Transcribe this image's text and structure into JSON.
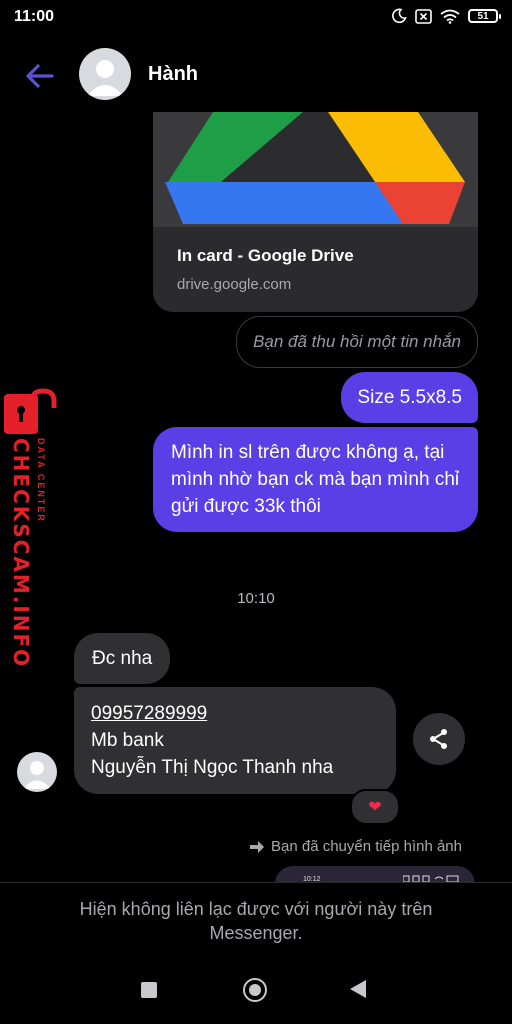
{
  "status_bar": {
    "time": "11:00",
    "battery": "51",
    "icons": [
      "moon-icon",
      "close-box-icon",
      "wifi-icon",
      "battery-icon"
    ]
  },
  "header": {
    "contact_name": "Hành",
    "accent_color": "#5b4fd6"
  },
  "messages": {
    "link_card": {
      "title": "In card - Google Drive",
      "domain": "drive.google.com"
    },
    "recalled_notice": "Bạn đã thu hồi một tin nhắn",
    "outgoing_size": "Size 5.5x8.5",
    "outgoing_long": "Mình in sl trên được không ạ, tại mình nhờ bạn ck mà bạn mình chỉ gửi được 33k thôi",
    "timestamp": "10:10",
    "incoming_dc": "Đc nha",
    "incoming_phone": "09957289999",
    "incoming_bank": "Mb bank",
    "incoming_name": "Nguyễn Thị Ngọc Thanh nha",
    "reaction": "❤",
    "forward_note": "Bạn đã chuyển tiếp hình ảnh",
    "forwarded_thumb_time": "10:12",
    "outgoing_bubble_color": "#5a3fe6",
    "incoming_bubble_color": "#303033"
  },
  "footer": {
    "notice": "Hiện không liên lạc được với người này trên Messenger."
  },
  "watermark": {
    "main": "CHECKSCAM.INFO",
    "sub": "DATA CENTER"
  }
}
